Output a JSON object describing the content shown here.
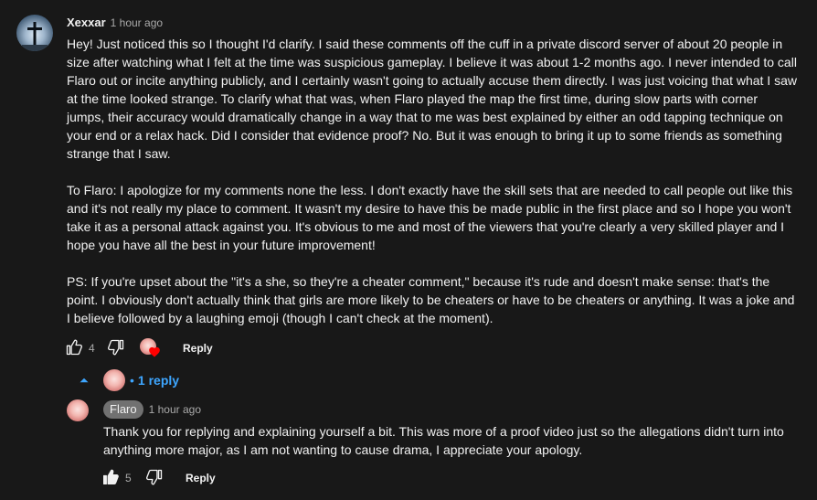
{
  "comment": {
    "author": "Xexxar",
    "time": "1 hour ago",
    "paragraphs": [
      "Hey! Just noticed this so I thought I'd clarify. I said these comments off the cuff in a private discord server of about 20 people in size after watching what I felt at the time was suspicious gameplay. I believe it was about 1-2 months ago. I never intended to call Flaro out or incite anything publicly, and I certainly wasn't going to actually accuse them directly. I was just voicing that what I saw at the time looked strange. To clarify what that was, when Flaro played the map the first time, during slow parts with corner jumps, their accuracy would dramatically change in a way that to me was best explained by either an odd tapping technique on your end or a relax hack. Did I consider that evidence proof? No. But it was enough to bring it up to some friends as something strange that I saw.",
      "To Flaro: I apologize for my comments none the less. I don't exactly have the skill sets that are needed to call people out like this and it's not really my place to comment. It wasn't my desire to have this be made public in the first place and so I hope you won't take it as a personal attack against you. It's obvious to me and most of the viewers that you're clearly a very skilled player and I hope you have all the best in your future improvement!",
      "PS: If you're upset about the \"it's a she, so they're a cheater comment,\" because it's rude and doesn't make sense: that's the point. I obviously don't actually think that girls are more likely to be cheaters or have to be cheaters or anything. It was a joke and I believe followed by a laughing emoji (though I can't check at the moment)."
    ],
    "likes": "4",
    "reply_label": "Reply",
    "replies_toggle": "1 reply",
    "replies_separator": "•"
  },
  "reply": {
    "author": "Flaro",
    "time": "1 hour ago",
    "text": "Thank you for replying and explaining yourself a bit. This was more of a proof video just so the allegations didn't turn into anything more major, as I am not wanting to cause drama, I appreciate your apology.",
    "likes": "5",
    "reply_label": "Reply"
  },
  "icons": {
    "like": "thumbs-up-icon",
    "dislike": "thumbs-down-icon",
    "creator_heart": "creator-heart-icon",
    "collapse": "chevron-up-icon"
  },
  "colors": {
    "background": "#181818",
    "text": "#f1f1f1",
    "muted": "#aaaaaa",
    "link": "#3ea6ff",
    "heart": "#ff0000",
    "chip": "#717171"
  }
}
